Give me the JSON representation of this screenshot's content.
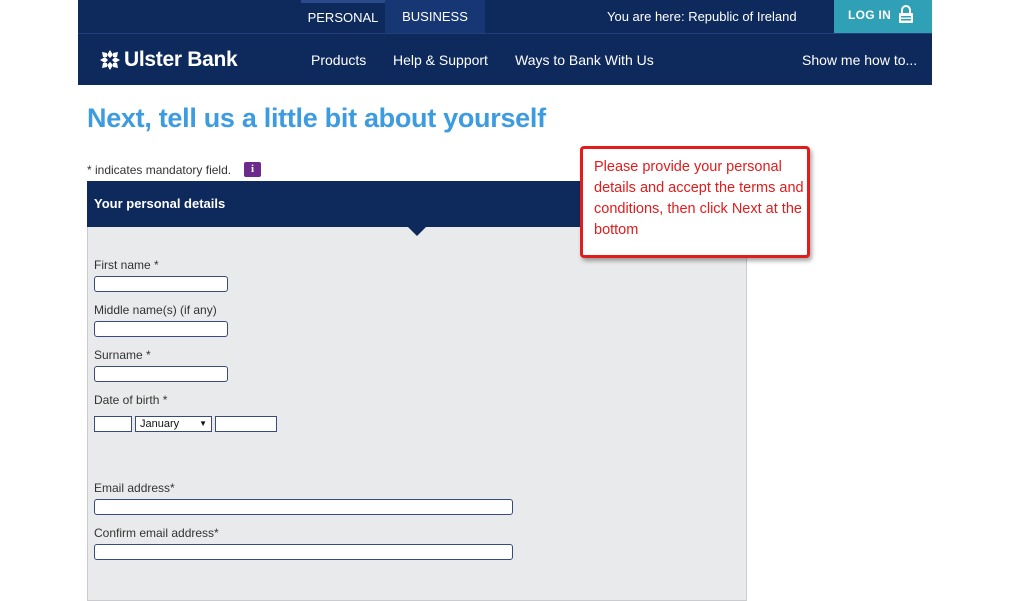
{
  "topbar": {
    "tabs": [
      {
        "label": "PERSONAL",
        "active": true
      },
      {
        "label": "BUSINESS",
        "active": false
      }
    ],
    "location": "You are here: Republic of Ireland",
    "login_label": "LOG IN",
    "login_icon": "lock-icon"
  },
  "nav": {
    "brand": "Ulster Bank",
    "brand_icon": "ulster-bank-logo-icon",
    "links": [
      "Products",
      "Help & Support",
      "Ways to Bank With Us"
    ],
    "right_link": "Show me how to..."
  },
  "page": {
    "title": "Next, tell us a little bit about yourself",
    "mandatory_note": "* indicates mandatory field.",
    "info_icon_glyph": "i"
  },
  "form": {
    "section_title": "Your personal details",
    "fields": {
      "first_name": {
        "label": "First name *",
        "value": ""
      },
      "middle_names": {
        "label": "Middle name(s) (if any)",
        "value": ""
      },
      "surname": {
        "label": "Surname *",
        "value": ""
      },
      "dob": {
        "label": "Date of birth *",
        "day": "",
        "month": "January",
        "year": ""
      },
      "email": {
        "label": "Email address*",
        "value": ""
      },
      "confirm_email": {
        "label": "Confirm email address*",
        "value": ""
      }
    }
  },
  "callout": {
    "text": "Please provide your personal details and accept the terms and conditions, then click Next at the bottom"
  },
  "colors": {
    "navy": "#0e2a5c",
    "login_teal": "#2fa0b6",
    "title_blue": "#3d9be0",
    "callout_red": "#e21b1b",
    "info_purple": "#6b2a8c"
  }
}
